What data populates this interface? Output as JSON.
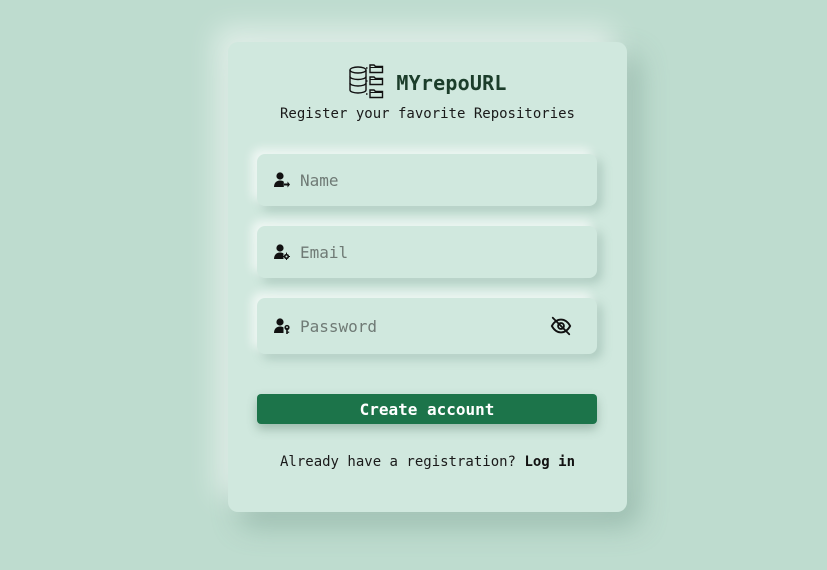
{
  "brand": {
    "title": "MYrepoURL",
    "logo_icon": "database-folders-icon"
  },
  "tagline": "Register your favorite Repositories",
  "form": {
    "name": {
      "placeholder": "Name",
      "value": "",
      "icon": "user-arrow-icon"
    },
    "email": {
      "placeholder": "Email",
      "value": "",
      "icon": "user-gear-icon"
    },
    "password": {
      "placeholder": "Password",
      "value": "",
      "icon": "user-key-icon",
      "toggle_icon": "eye-slash-icon"
    }
  },
  "create_button": {
    "label": "Create account"
  },
  "login": {
    "prompt": "Already have a registration?",
    "link_label": "Log in"
  },
  "colors": {
    "background": "#bedccf",
    "card": "#d0e8de",
    "primary_button": "#1c744a",
    "brand_text": "#1b3d2a"
  }
}
